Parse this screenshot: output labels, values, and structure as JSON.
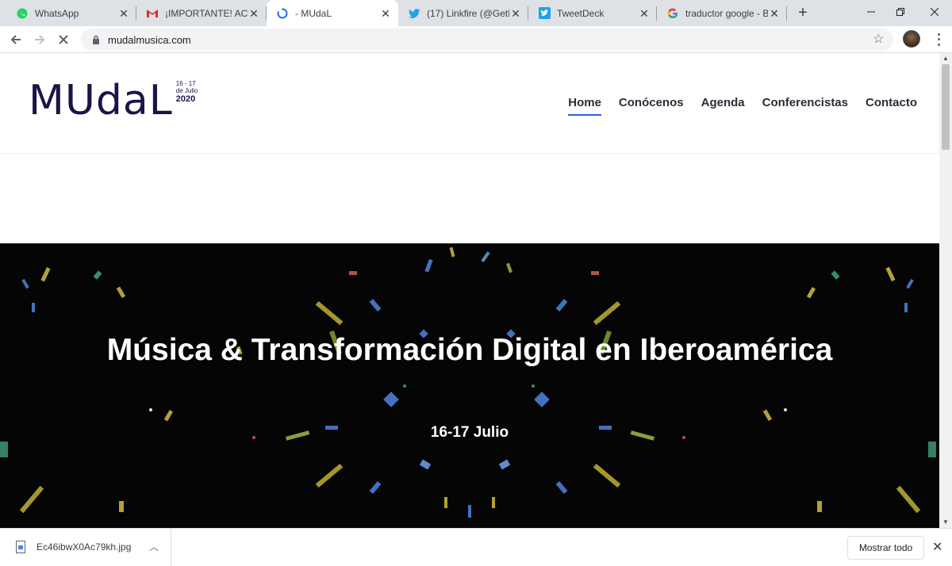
{
  "browser": {
    "tabs": [
      {
        "title": "WhatsApp",
        "icon": "whatsapp-icon",
        "color": "#25d366"
      },
      {
        "title": "¡IMPORTANTE! ACCE",
        "icon": "gmail-icon",
        "color": "#d93025"
      },
      {
        "title": "- MUdaL",
        "icon": "loading-spinner-icon",
        "color": "#1a73e8"
      },
      {
        "title": "(17) Linkfire (@GetLi",
        "icon": "twitter-icon",
        "color": "#1da1f2"
      },
      {
        "title": "TweetDeck",
        "icon": "tweetdeck-icon",
        "color": "#1da1f2"
      },
      {
        "title": "traductor google - B",
        "icon": "google-icon",
        "color": "#4285f4"
      }
    ],
    "new_tab": "+",
    "url": "mudalmusica.com"
  },
  "site": {
    "logo": {
      "mark": "MUdaL",
      "date_line1": "16 - 17",
      "date_line2": "de Julio",
      "year": "2020"
    },
    "nav": [
      {
        "label": "Home"
      },
      {
        "label": "Conócenos"
      },
      {
        "label": "Agenda"
      },
      {
        "label": "Conferencistas"
      },
      {
        "label": "Contacto"
      }
    ],
    "hero": {
      "title": "Música & Transformación Digital en Iberoamérica",
      "date": "16-17 Julio"
    }
  },
  "downloads": {
    "file_name": "Ec46ibwX0Ac79kh.jpg",
    "show_all": "Mostrar todo"
  },
  "colors": {
    "brand": "#1a1446",
    "nav_active_underline": "#2b5ce6",
    "hero_bg": "#050505"
  }
}
